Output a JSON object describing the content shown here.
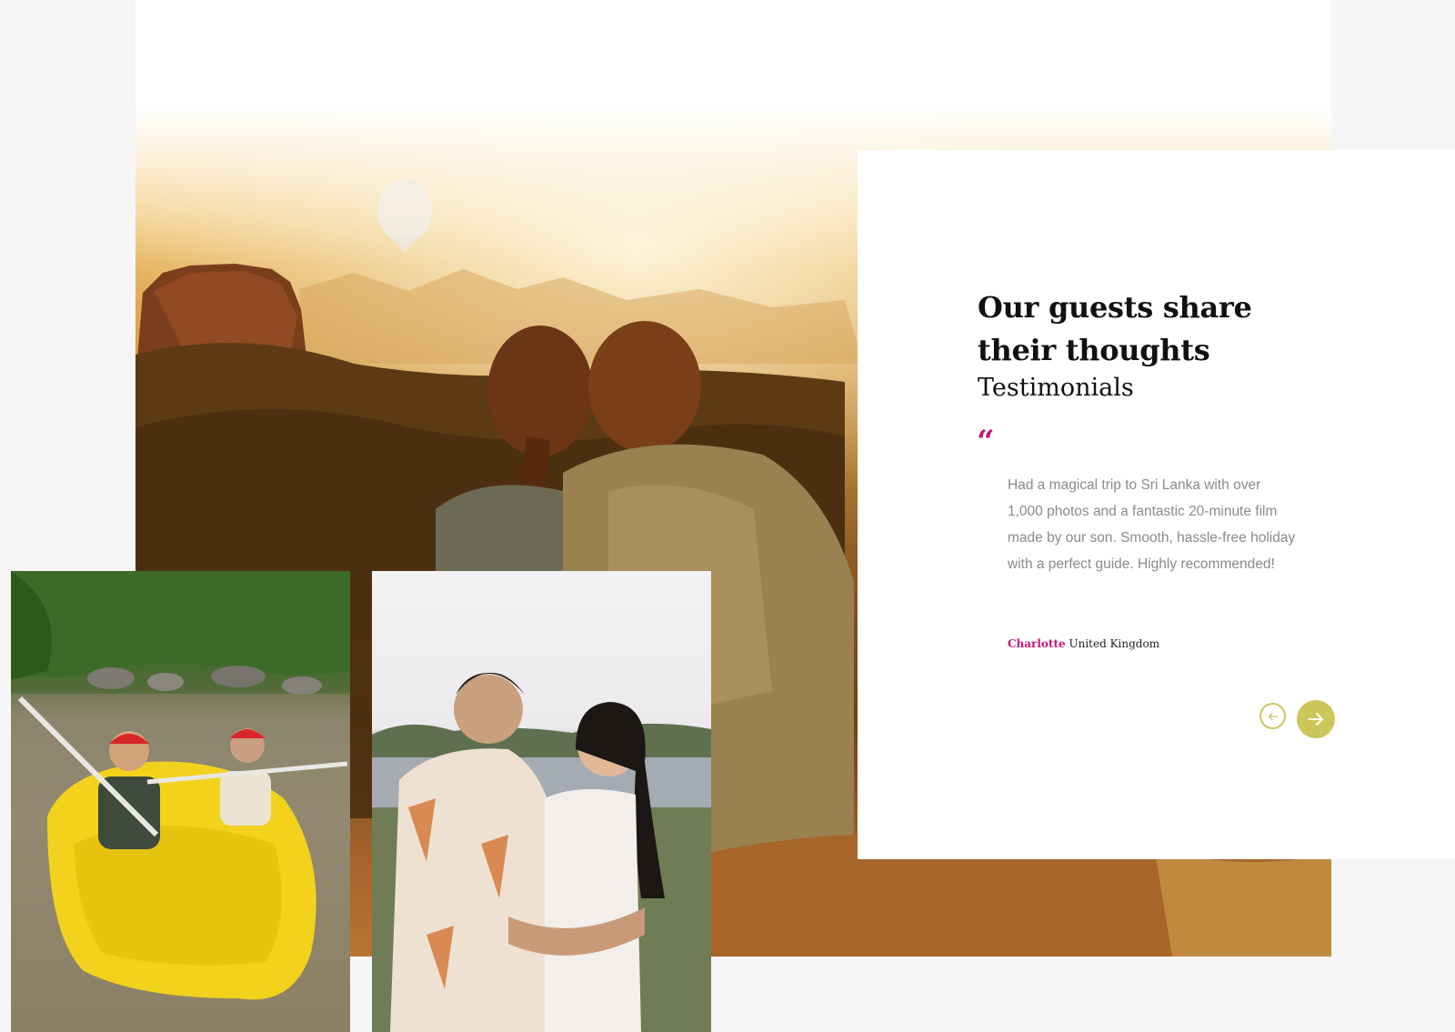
{
  "testimonials": {
    "heading": "Our guests share their thoughts",
    "subheading": "Testimonials",
    "quote_mark": "“",
    "quote": "Had a magical trip to Sri Lanka with over 1,000 photos and a fantastic 20-minute film made by our son. Smooth, hassle-free holiday with a perfect guide. Highly recommended!",
    "author_name": "Charlotte",
    "author_country": "United Kingdom",
    "prev_icon": "arrow-left-icon",
    "next_icon": "arrow-right-icon"
  },
  "images": {
    "hero": "couple watching sunset over Sigiriya rock with hot air balloon",
    "raft": "two guests white-water rafting in a yellow raft",
    "couple": "couple embracing by a lake"
  },
  "colors": {
    "accent_magenta": "#c2187e",
    "accent_olive": "#cdc75b",
    "heading": "#111111",
    "body_text": "#8a8a8a",
    "panel_bg": "#ffffff",
    "page_bg": "#f6f6f6"
  }
}
